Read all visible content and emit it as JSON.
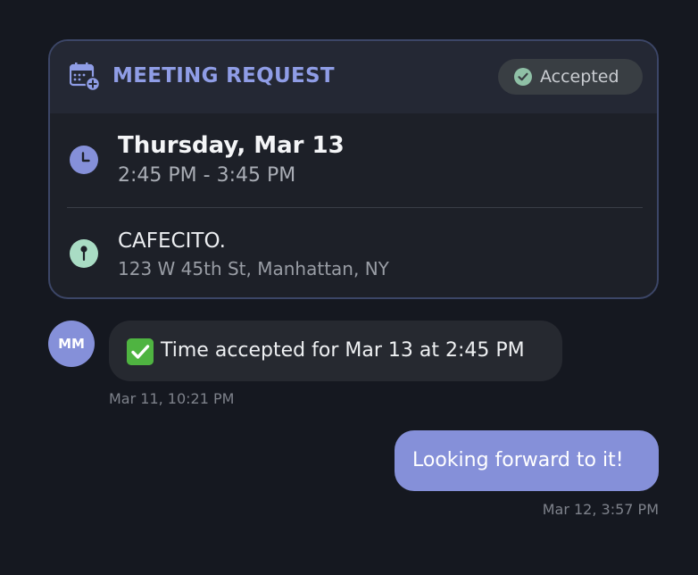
{
  "meeting_card": {
    "title": "MEETING REQUEST",
    "status": "Accepted",
    "date": "Thursday, Mar 13",
    "time_range": "2:45 PM - 3:45 PM",
    "place_name": "CAFECITO.",
    "place_address": "123 W 45th St, Manhattan, NY",
    "icons": {
      "header": "calendar-add-icon",
      "status": "check-circle-icon",
      "time": "clock-icon",
      "location": "location-pin-icon"
    }
  },
  "messages": [
    {
      "direction": "incoming",
      "avatar_initials": "MM",
      "emoji_icon": "check-mark-button-icon",
      "text": "Time accepted for Mar 13 at 2:45 PM",
      "timestamp": "Mar 11, 10:21 PM"
    },
    {
      "direction": "outgoing",
      "text": "Looking forward to it!",
      "timestamp": "Mar 12, 3:57 PM"
    }
  ],
  "colors": {
    "background": "#151820",
    "accent": "#8590d9",
    "card_border": "#3c4667",
    "card_header": "#242834",
    "status_check": "#8fc0a6",
    "location_icon": "#a9dcc4"
  }
}
